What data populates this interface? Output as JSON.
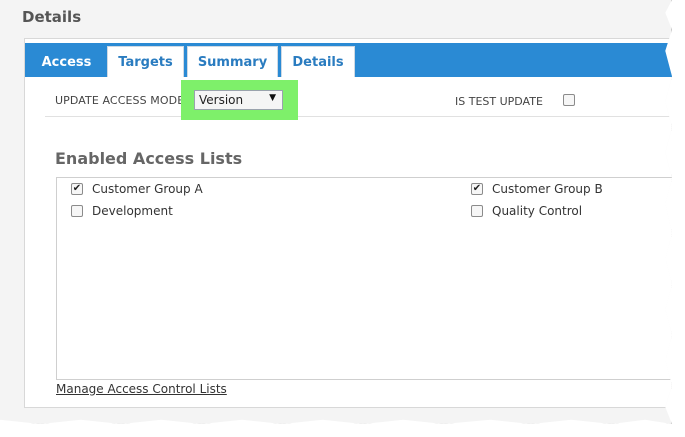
{
  "page_title": "Details",
  "tabs": [
    {
      "label": "Access",
      "active": true
    },
    {
      "label": "Targets",
      "active": false
    },
    {
      "label": "Summary",
      "active": false
    },
    {
      "label": "Details",
      "active": false
    }
  ],
  "update_access_mode": {
    "label": "UPDATE ACCESS MODE",
    "value": "Version",
    "highlight_color": "#7ef06a"
  },
  "is_test_update": {
    "label": "IS TEST UPDATE",
    "checked": false
  },
  "access_lists": {
    "title": "Enabled Access Lists",
    "items": [
      {
        "label": "Customer Group A",
        "checked": true
      },
      {
        "label": "Customer Group B",
        "checked": true
      },
      {
        "label": "Development",
        "checked": false
      },
      {
        "label": "Quality Control",
        "checked": false
      }
    ]
  },
  "manage_link": "Manage Access Control Lists",
  "colors": {
    "tab_bar": "#2a8ad4",
    "tab_text": "#2a7cc0"
  }
}
